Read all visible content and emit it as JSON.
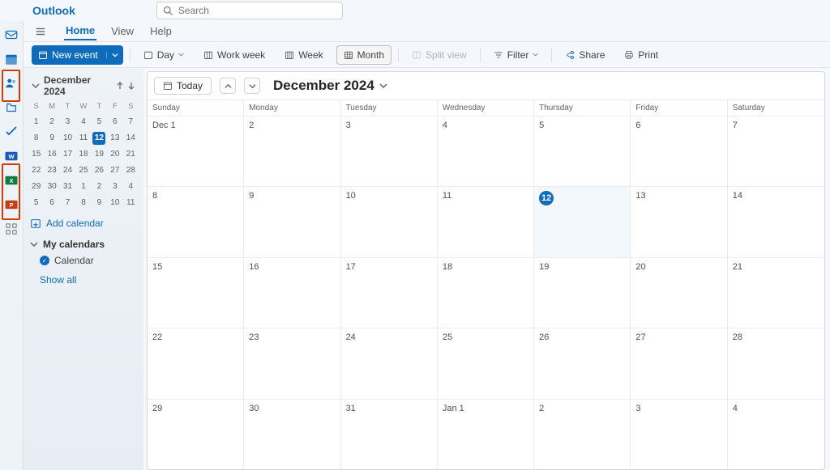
{
  "brand": "Outlook",
  "search_placeholder": "Search",
  "tabs": {
    "home": "Home",
    "view": "View",
    "help": "Help"
  },
  "ribbon": {
    "new_event": "New event",
    "day": "Day",
    "workweek": "Work week",
    "week": "Week",
    "month": "Month",
    "split": "Split view",
    "filter": "Filter",
    "share": "Share",
    "print": "Print"
  },
  "today_btn": "Today",
  "month_title": "December 2024",
  "day_headers": [
    "Sunday",
    "Monday",
    "Tuesday",
    "Wednesday",
    "Thursday",
    "Friday",
    "Saturday"
  ],
  "sidebar": {
    "mini_title": "December 2024",
    "mini_dh": [
      "S",
      "M",
      "T",
      "W",
      "T",
      "F",
      "S"
    ],
    "mini_days": [
      "1",
      "2",
      "3",
      "4",
      "5",
      "6",
      "7",
      "8",
      "9",
      "10",
      "11",
      "12",
      "13",
      "14",
      "15",
      "16",
      "17",
      "18",
      "19",
      "20",
      "21",
      "22",
      "23",
      "24",
      "25",
      "26",
      "27",
      "28",
      "29",
      "30",
      "31",
      "1",
      "2",
      "3",
      "4",
      "5",
      "6",
      "7",
      "8",
      "9",
      "10",
      "11"
    ],
    "mini_today_idx": 11,
    "add_calendar": "Add calendar",
    "my_calendars": "My calendars",
    "calendar_item": "Calendar",
    "show_all": "Show all"
  },
  "grid": {
    "cells": [
      "Dec 1",
      "2",
      "3",
      "4",
      "5",
      "6",
      "7",
      "8",
      "9",
      "10",
      "11",
      "12",
      "13",
      "14",
      "15",
      "16",
      "17",
      "18",
      "19",
      "20",
      "21",
      "22",
      "23",
      "24",
      "25",
      "26",
      "27",
      "28",
      "29",
      "30",
      "31",
      "Jan 1",
      "2",
      "3",
      "4"
    ],
    "today_idx": 11
  }
}
